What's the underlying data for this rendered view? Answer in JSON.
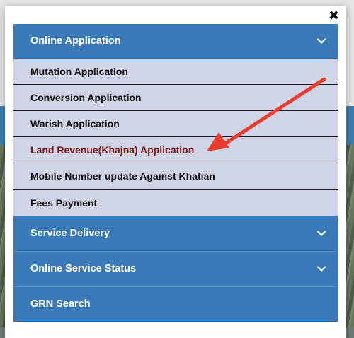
{
  "modal": {
    "close_symbol": "✖"
  },
  "menu": {
    "online_application": {
      "label": "Online Application",
      "items": [
        {
          "label": "Mutation Application"
        },
        {
          "label": "Conversion Application"
        },
        {
          "label": "Warish Application"
        },
        {
          "label": "Land Revenue(Khajna) Application"
        },
        {
          "label": "Mobile Number update Against Khatian"
        },
        {
          "label": "Fees Payment"
        }
      ]
    },
    "service_delivery": {
      "label": "Service Delivery"
    },
    "online_service_status": {
      "label": "Online Service Status"
    },
    "grn_search": {
      "label": "GRN Search"
    }
  },
  "colors": {
    "header_bg": "#3a7ab8",
    "item_bg": "#cfd4e6",
    "active_item_text": "#7a1414",
    "annotation_arrow": "#ee3a2a"
  },
  "icons": {
    "close": "close-icon",
    "chevron": "chevron-down-icon",
    "annotation": "red-arrow"
  }
}
